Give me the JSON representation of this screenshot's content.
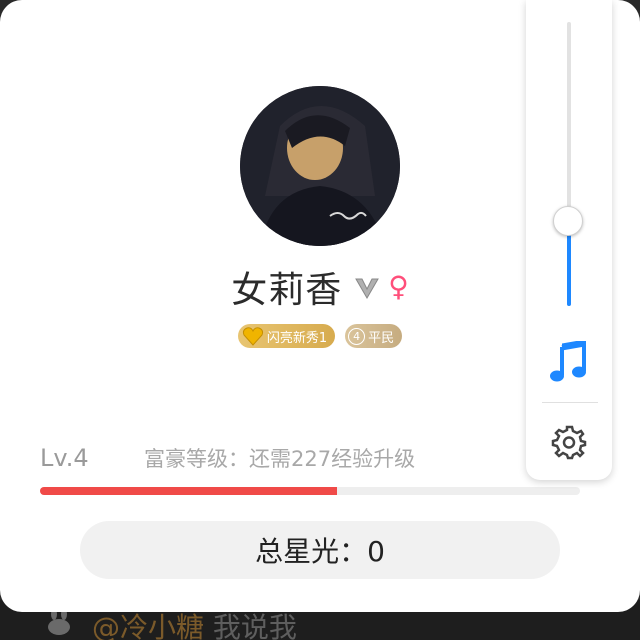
{
  "profile": {
    "name": "女莉香",
    "gender_symbol": "♀",
    "badges": {
      "honor": {
        "label": "闪亮新秀1",
        "icon": "heart-icon"
      },
      "rank": {
        "number": "4",
        "label": "平民"
      }
    },
    "level": "Lv.4",
    "level_hint": "富豪等级：还需227经验升级",
    "level_progress": 0.55,
    "total_stars": "总星光：0"
  },
  "side_panel": {
    "volume": 0.3,
    "icons": [
      "music-note-icon",
      "gear-icon"
    ]
  },
  "background_chat": {
    "username": "@冷小糖",
    "message": "我说我"
  },
  "colors": {
    "progress": "#f04a48",
    "accent": "#1e88ff",
    "gender": "#ff4f7b",
    "badge_gold": "#d7ab4e",
    "badge_tan": "#c6ac80"
  }
}
